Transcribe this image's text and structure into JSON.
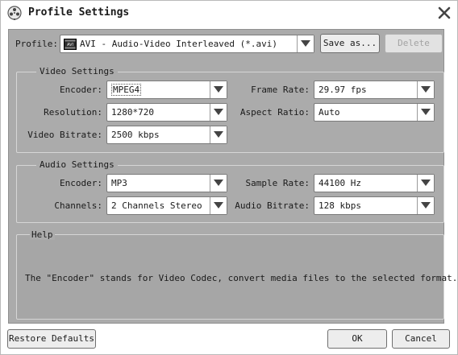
{
  "window": {
    "title": "Profile Settings",
    "icons": {
      "app": "reel-icon",
      "close": "close-icon"
    }
  },
  "profile": {
    "label": "Profile:",
    "value": "AVI - Audio-Video Interleaved (*.avi)",
    "format_badge": "AVI",
    "save_as_label": "Save as...",
    "delete_label": "Delete"
  },
  "video": {
    "title": "Video Settings",
    "encoder_label": "Encoder:",
    "encoder_value": "MPEG4",
    "resolution_label": "Resolution:",
    "resolution_value": "1280*720",
    "bitrate_label": "Video Bitrate:",
    "bitrate_value": "2500 kbps",
    "frame_rate_label": "Frame Rate:",
    "frame_rate_value": "29.97 fps",
    "aspect_ratio_label": "Aspect Ratio:",
    "aspect_ratio_value": "Auto"
  },
  "audio": {
    "title": "Audio Settings",
    "encoder_label": "Encoder:",
    "encoder_value": "MP3",
    "channels_label": "Channels:",
    "channels_value": "2 Channels Stereo",
    "sample_rate_label": "Sample Rate:",
    "sample_rate_value": "44100 Hz",
    "bitrate_label": "Audio Bitrate:",
    "bitrate_value": "128 kbps"
  },
  "help": {
    "title": "Help",
    "text": "The \"Encoder\" stands for Video Codec, convert media files to the selected format."
  },
  "footer": {
    "restore_label": "Restore Defaults",
    "ok_label": "OK",
    "cancel_label": "Cancel"
  },
  "colors": {
    "panel": "#ababab",
    "help_panel": "#a6a6a6",
    "group_border": "#d6d6d6",
    "disabled_text": "#a3a3a3"
  }
}
